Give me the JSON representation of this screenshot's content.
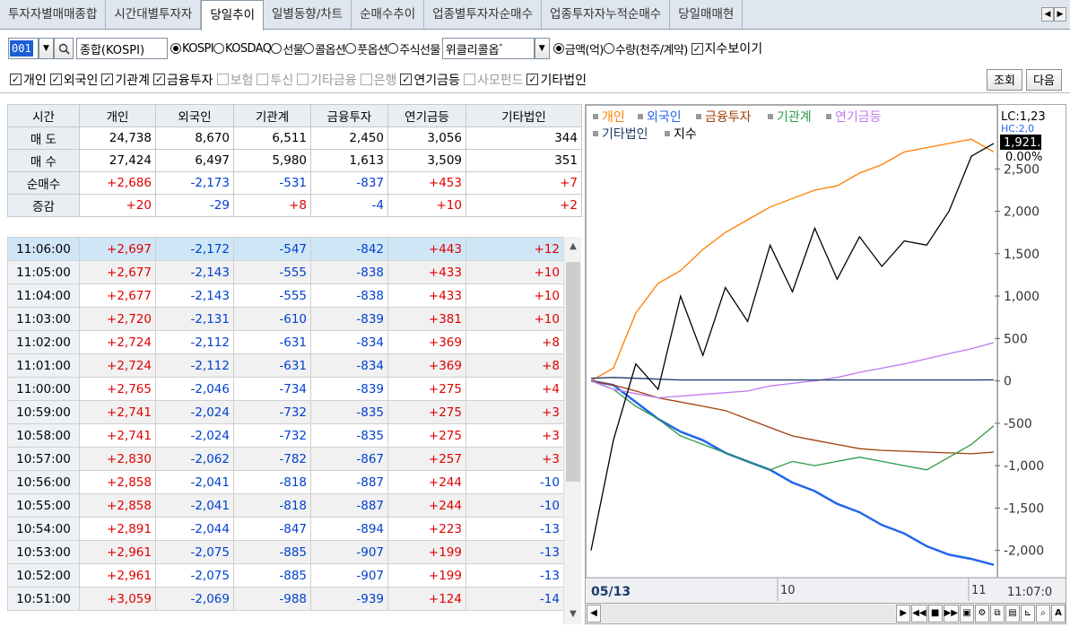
{
  "tabs": [
    "투자자별매매종합",
    "시간대별투자자",
    "당일추이",
    "일별동향/차트",
    "순매수추이",
    "업종별투자자순매수",
    "업종투자자누적순매수",
    "당일매매현"
  ],
  "tab_arrows": [
    "◀",
    "▶"
  ],
  "toolbar": {
    "code": "001",
    "market_label": "종합(KOSPI)",
    "radios": [
      "KOSPI",
      "KOSDAQ",
      "선물",
      "콜옵션",
      "풋옵션",
      "주식선물"
    ],
    "weekly_label": "위클리콜옵ﾞ",
    "unit_radios": [
      "금액(억)",
      "수량(천주/계약)"
    ],
    "index_toggle": "지수보이기"
  },
  "filters": {
    "items": [
      {
        "l": "개인",
        "c": true
      },
      {
        "l": "외국인",
        "c": true
      },
      {
        "l": "기관계",
        "c": true
      },
      {
        "l": "금융투자",
        "c": true
      },
      {
        "l": "보험",
        "c": false
      },
      {
        "l": "투신",
        "c": false
      },
      {
        "l": "기타금융",
        "c": false
      },
      {
        "l": "은행",
        "c": false
      },
      {
        "l": "연기금등",
        "c": true
      },
      {
        "l": "사모펀드",
        "c": false
      },
      {
        "l": "기타법인",
        "c": true
      }
    ],
    "query_btn": "조회",
    "next_btn": "다음"
  },
  "summary": {
    "headers": [
      "시간",
      "개인",
      "외국인",
      "기관계",
      "금융투자",
      "연기금등",
      "기타법인"
    ],
    "rows": [
      {
        "label": "매 도",
        "v": [
          "24,738",
          "8,670",
          "6,511",
          "2,450",
          "3,056",
          "344"
        ],
        "colored": false
      },
      {
        "label": "매 수",
        "v": [
          "27,424",
          "6,497",
          "5,980",
          "1,613",
          "3,509",
          "351"
        ],
        "colored": false
      },
      {
        "label": "순매수",
        "v": [
          "+2,686",
          "-2,173",
          "-531",
          "-837",
          "+453",
          "+7"
        ],
        "colored": true
      },
      {
        "label": "증감",
        "v": [
          "+20",
          "-29",
          "+8",
          "-4",
          "+10",
          "+2"
        ],
        "colored": true
      }
    ]
  },
  "detail": [
    {
      "t": "11:06:00",
      "v": [
        "+2,697",
        "-2,172",
        "-547",
        "-842",
        "+443",
        "+12"
      ]
    },
    {
      "t": "11:05:00",
      "v": [
        "+2,677",
        "-2,143",
        "-555",
        "-838",
        "+433",
        "+10"
      ]
    },
    {
      "t": "11:04:00",
      "v": [
        "+2,677",
        "-2,143",
        "-555",
        "-838",
        "+433",
        "+10"
      ]
    },
    {
      "t": "11:03:00",
      "v": [
        "+2,720",
        "-2,131",
        "-610",
        "-839",
        "+381",
        "+10"
      ]
    },
    {
      "t": "11:02:00",
      "v": [
        "+2,724",
        "-2,112",
        "-631",
        "-834",
        "+369",
        "+8"
      ]
    },
    {
      "t": "11:01:00",
      "v": [
        "+2,724",
        "-2,112",
        "-631",
        "-834",
        "+369",
        "+8"
      ]
    },
    {
      "t": "11:00:00",
      "v": [
        "+2,765",
        "-2,046",
        "-734",
        "-839",
        "+275",
        "+4"
      ]
    },
    {
      "t": "10:59:00",
      "v": [
        "+2,741",
        "-2,024",
        "-732",
        "-835",
        "+275",
        "+3"
      ]
    },
    {
      "t": "10:58:00",
      "v": [
        "+2,741",
        "-2,024",
        "-732",
        "-835",
        "+275",
        "+3"
      ]
    },
    {
      "t": "10:57:00",
      "v": [
        "+2,830",
        "-2,062",
        "-782",
        "-867",
        "+257",
        "+3"
      ]
    },
    {
      "t": "10:56:00",
      "v": [
        "+2,858",
        "-2,041",
        "-818",
        "-887",
        "+244",
        "-10"
      ]
    },
    {
      "t": "10:55:00",
      "v": [
        "+2,858",
        "-2,041",
        "-818",
        "-887",
        "+244",
        "-10"
      ]
    },
    {
      "t": "10:54:00",
      "v": [
        "+2,891",
        "-2,044",
        "-847",
        "-894",
        "+223",
        "-13"
      ]
    },
    {
      "t": "10:53:00",
      "v": [
        "+2,961",
        "-2,075",
        "-885",
        "-907",
        "+199",
        "-13"
      ]
    },
    {
      "t": "10:52:00",
      "v": [
        "+2,961",
        "-2,075",
        "-885",
        "-907",
        "+199",
        "-13"
      ]
    },
    {
      "t": "10:51:00",
      "v": [
        "+3,059",
        "-2,069",
        "-988",
        "-939",
        "+124",
        "-14"
      ]
    }
  ],
  "chart": {
    "legend": [
      {
        "n": "개인",
        "c": "#ff7f00"
      },
      {
        "n": "외국인",
        "c": "#2266ee"
      },
      {
        "n": "금융투자",
        "c": "#a0400a"
      },
      {
        "n": "기관계",
        "c": "#2a9a48"
      },
      {
        "n": "연기금등",
        "c": "#c078f0"
      },
      {
        "n": "기타법인",
        "c": "#1c3a6a"
      },
      {
        "n": "지수",
        "c": "#000000"
      }
    ],
    "lc_label": "LC:1,23",
    "hc_label": "HC:2,0",
    "index_value": "1,921.",
    "pct_label": "0.00%",
    "y_ticks": [
      "2,500",
      "2,000",
      "1,500",
      "1,000",
      "500",
      "0",
      "-500",
      "-1,000",
      "-1,500",
      "-2,000"
    ],
    "date_label": "05/13",
    "x_ticks": [
      "10",
      "11"
    ],
    "time_label": "11:07:0"
  },
  "chart_data": {
    "type": "line",
    "ylim": [
      -2300,
      3000
    ],
    "series": [
      {
        "name": "개인",
        "color": "#ff7f00",
        "values": [
          0,
          150,
          800,
          1150,
          1300,
          1550,
          1750,
          1900,
          2050,
          2150,
          2250,
          2300,
          2450,
          2550,
          2700,
          2750,
          2800,
          2850,
          2700
        ]
      },
      {
        "name": "외국인",
        "color": "#2266ee",
        "values": [
          0,
          -50,
          -250,
          -450,
          -600,
          -700,
          -850,
          -950,
          -1050,
          -1200,
          -1300,
          -1450,
          -1550,
          -1700,
          -1800,
          -1950,
          -2050,
          -2100,
          -2170
        ]
      },
      {
        "name": "금융투자",
        "color": "#a0400a",
        "values": [
          0,
          -50,
          -120,
          -200,
          -250,
          -300,
          -350,
          -450,
          -550,
          -650,
          -700,
          -750,
          -800,
          -820,
          -830,
          -840,
          -850,
          -860,
          -840
        ]
      },
      {
        "name": "기관계",
        "color": "#2a9a48",
        "values": [
          0,
          -100,
          -300,
          -450,
          -650,
          -750,
          -850,
          -950,
          -1050,
          -950,
          -1000,
          -950,
          -900,
          -950,
          -1000,
          -1050,
          -900,
          -750,
          -530
        ]
      },
      {
        "name": "연기금등",
        "color": "#c078f0",
        "values": [
          0,
          -100,
          -150,
          -200,
          -180,
          -160,
          -140,
          -120,
          -60,
          -30,
          0,
          40,
          100,
          150,
          200,
          260,
          320,
          380,
          450
        ]
      },
      {
        "name": "기타법인",
        "color": "#1c3a6a",
        "values": [
          30,
          40,
          30,
          20,
          10,
          10,
          10,
          10,
          10,
          10,
          10,
          10,
          10,
          10,
          10,
          10,
          10,
          10,
          12
        ]
      },
      {
        "name": "지수",
        "color": "#000000",
        "values": [
          -2000,
          -700,
          200,
          -100,
          1000,
          300,
          1100,
          700,
          1600,
          1050,
          1800,
          1200,
          1700,
          1350,
          1650,
          1600,
          2000,
          2650,
          2800
        ]
      }
    ]
  }
}
